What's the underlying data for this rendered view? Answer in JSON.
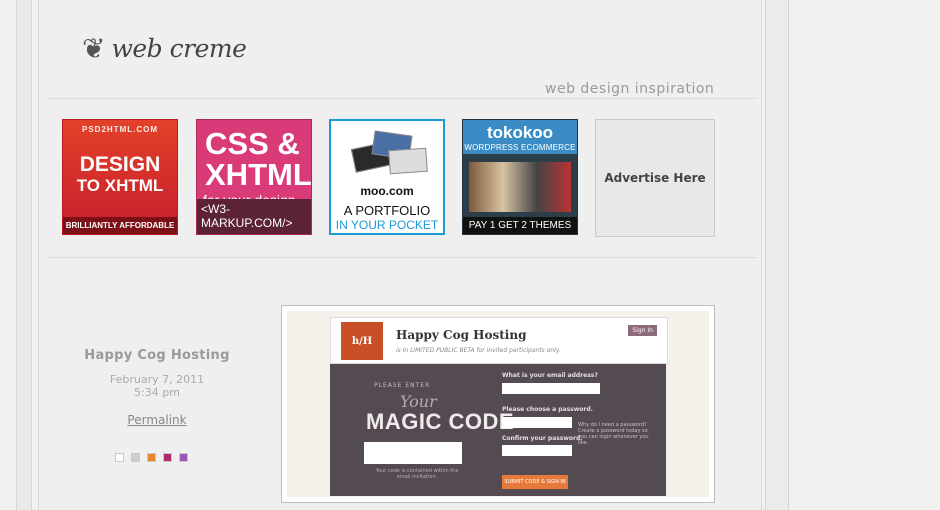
{
  "header": {
    "logo_text": "web creme",
    "tagline": "web design inspiration"
  },
  "ads": [
    {
      "id": "psd2html",
      "top": "PSD2HTML.COM",
      "line1": "DESIGN",
      "line2": "TO XHTML",
      "bottom": "BRILLIANTLY AFFORDABLE"
    },
    {
      "id": "w3markup",
      "line1": "CSS &",
      "line2": "XHTML",
      "line3": "for your design",
      "bottom": "<W3-MARKUP.COM/>"
    },
    {
      "id": "moo",
      "brand": "moo.com",
      "line1": "A PORTFOLIO",
      "line2": "IN YOUR POCKET"
    },
    {
      "id": "tokokoo",
      "brand": "tokokoo",
      "sub": "WORDPRESS ECOMMERCE",
      "bottom": "PAY 1 GET 2 THEMES"
    },
    {
      "id": "advertise",
      "label": "Advertise Here"
    }
  ],
  "post": {
    "title": "Happy Cog Hosting",
    "date": "February 7, 2011",
    "time": "5:34 pm",
    "permalink_label": "Permalink",
    "swatches": [
      "#ffffff",
      "#cfcfcf",
      "#e8892e",
      "#b0286a",
      "#9c54b8"
    ]
  },
  "screenshot": {
    "logo": "h/H",
    "title": "Happy Cog Hosting",
    "beta_text": "is in LIMITED PUBLIC BETA for invited participants only.",
    "signin": "Sign In",
    "please_enter": "PLEASE ENTER",
    "your": "Your",
    "magic_code": "MAGIC CODE",
    "code_note": "Your code is contained within the email invitation.",
    "email_label": "What is your email address?",
    "password_label": "Please choose a password.",
    "confirm_label": "Confirm your password.",
    "why_text": "Why do I need a password? Create a password today so you can login whenever you like.",
    "submit": "SUBMIT CODE & SIGN IN"
  }
}
